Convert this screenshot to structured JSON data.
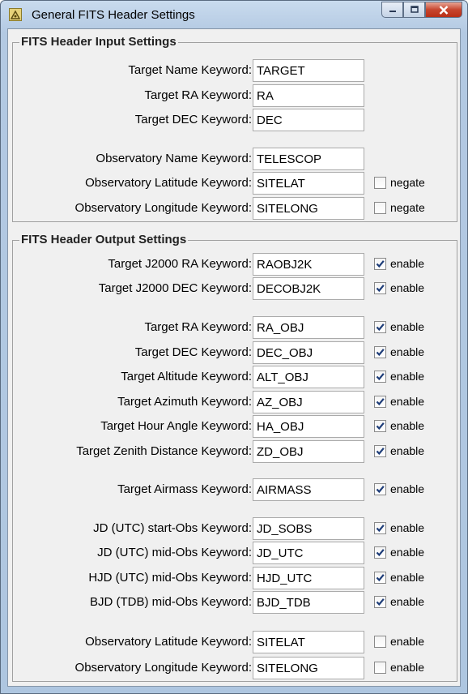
{
  "window": {
    "title": "General FITS Header Settings"
  },
  "input_group": {
    "title": "FITS Header Input Settings",
    "rows": [
      {
        "label": "Target Name Keyword:",
        "value": "TARGET"
      },
      {
        "label": "Target RA Keyword:",
        "value": "RA"
      },
      {
        "label": "Target DEC Keyword:",
        "value": "DEC"
      },
      {
        "label": "Observatory Name Keyword:",
        "value": "TELESCOP"
      },
      {
        "label": "Observatory Latitude Keyword:",
        "value": "SITELAT",
        "checkbox": "negate",
        "checked": false
      },
      {
        "label": "Observatory Longitude Keyword:",
        "value": "SITELONG",
        "checkbox": "negate",
        "checked": false
      }
    ]
  },
  "output_group": {
    "title": "FITS Header Output Settings",
    "rows": [
      {
        "label": "Target J2000 RA Keyword:",
        "value": "RAOBJ2K",
        "checkbox": "enable",
        "checked": true
      },
      {
        "label": "Target J2000 DEC Keyword:",
        "value": "DECOBJ2K",
        "checkbox": "enable",
        "checked": true
      },
      {
        "label": "Target RA Keyword:",
        "value": "RA_OBJ",
        "checkbox": "enable",
        "checked": true
      },
      {
        "label": "Target DEC Keyword:",
        "value": "DEC_OBJ",
        "checkbox": "enable",
        "checked": true
      },
      {
        "label": "Target Altitude Keyword:",
        "value": "ALT_OBJ",
        "checkbox": "enable",
        "checked": true
      },
      {
        "label": "Target Azimuth Keyword:",
        "value": "AZ_OBJ",
        "checkbox": "enable",
        "checked": true
      },
      {
        "label": "Target Hour Angle Keyword:",
        "value": "HA_OBJ",
        "checkbox": "enable",
        "checked": true
      },
      {
        "label": "Target Zenith Distance Keyword:",
        "value": "ZD_OBJ",
        "checkbox": "enable",
        "checked": true
      },
      {
        "label": "Target Airmass Keyword:",
        "value": "AIRMASS",
        "checkbox": "enable",
        "checked": true
      },
      {
        "label": "JD (UTC) start-Obs Keyword:",
        "value": "JD_SOBS",
        "checkbox": "enable",
        "checked": true
      },
      {
        "label": "JD (UTC) mid-Obs Keyword:",
        "value": "JD_UTC",
        "checkbox": "enable",
        "checked": true
      },
      {
        "label": "HJD (UTC) mid-Obs Keyword:",
        "value": "HJD_UTC",
        "checkbox": "enable",
        "checked": true
      },
      {
        "label": "BJD (TDB) mid-Obs Keyword:",
        "value": "BJD_TDB",
        "checkbox": "enable",
        "checked": true
      },
      {
        "label": "Observatory Latitude Keyword:",
        "value": "SITELAT",
        "checkbox": "enable",
        "checked": false
      },
      {
        "label": "Observatory Longitude Keyword:",
        "value": "SITELONG",
        "checkbox": "enable",
        "checked": false
      }
    ]
  }
}
